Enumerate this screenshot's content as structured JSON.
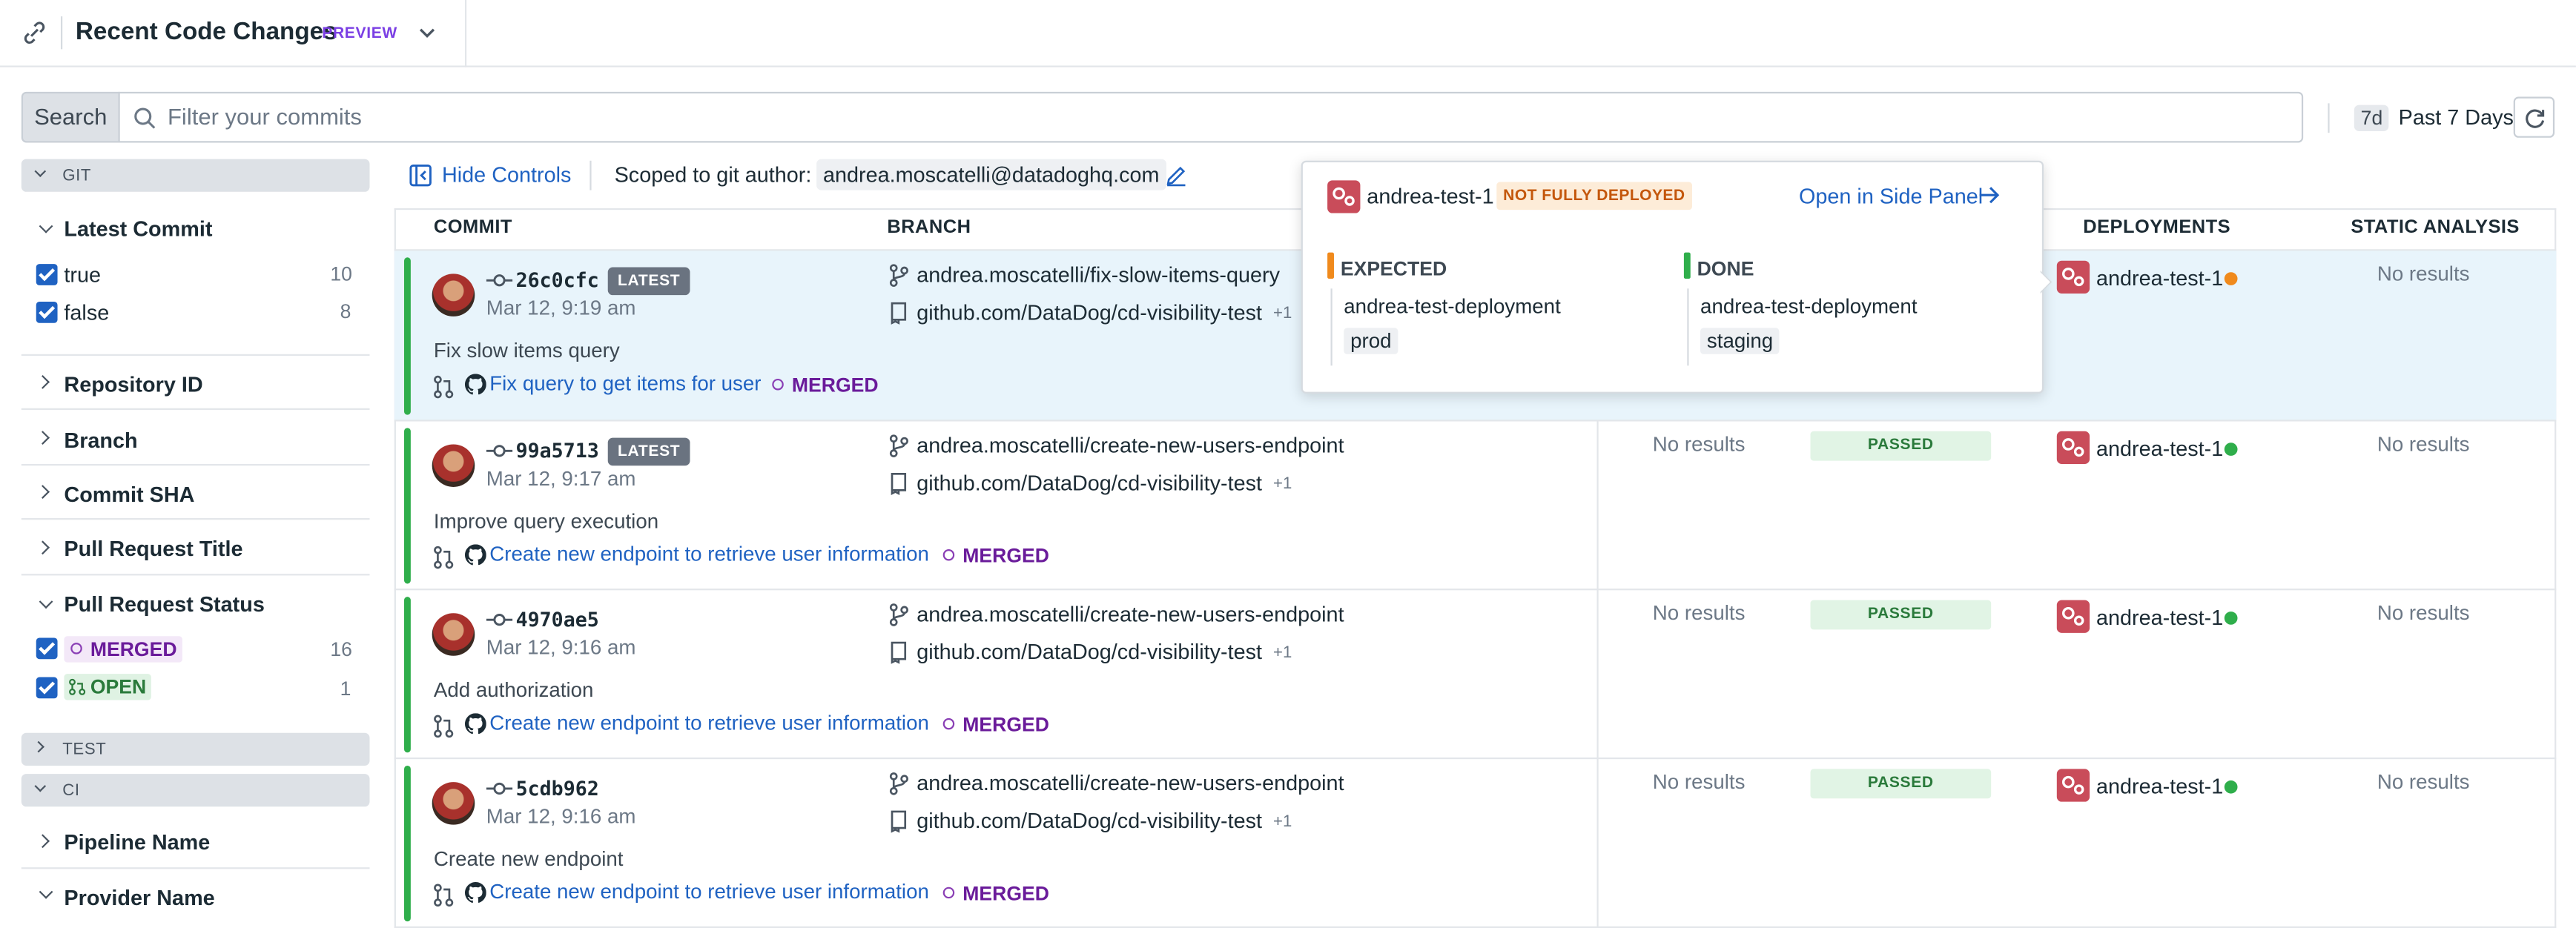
{
  "header": {
    "title": "Recent Code Changes",
    "preview": "PREVIEW"
  },
  "search": {
    "button": "Search",
    "placeholder": "Filter your commits",
    "time_short": "7d",
    "time_label": "Past 7 Days"
  },
  "controls": {
    "hide": "Hide Controls",
    "scoped_label": "Scoped to git author:",
    "author": "andrea.moscatelli@datadoghq.com"
  },
  "sidebar": {
    "git": "GIT",
    "latest_commit": "Latest Commit",
    "lc_options": [
      {
        "label": "true",
        "count": "10"
      },
      {
        "label": "false",
        "count": "8"
      }
    ],
    "facets": [
      "Repository ID",
      "Branch",
      "Commit SHA",
      "Pull Request Title"
    ],
    "pr_status": "Pull Request Status",
    "pr_options": [
      {
        "label": "MERGED",
        "count": "16"
      },
      {
        "label": "OPEN",
        "count": "1"
      }
    ],
    "test": "TEST",
    "ci": "CI",
    "pipeline": "Pipeline Name",
    "provider": "Provider Name"
  },
  "table": {
    "columns": [
      "COMMIT",
      "BRANCH",
      "DEPLOYMENTS",
      "STATIC ANALYSIS"
    ],
    "rows": [
      {
        "sha": "26c0cfc",
        "latest": "LATEST",
        "date": "Mar 12, 9:19 am",
        "message": "Fix slow items query",
        "pr": "Fix query to get items for user",
        "status": "MERGED",
        "branch": "andrea.moscatelli/fix-slow-items-query",
        "repo": "github.com/DataDog/cd-visibility-test",
        "repo_more": "+1",
        "col3": "",
        "col4": "",
        "deployment": "andrea-test-1",
        "static": "No results"
      },
      {
        "sha": "99a5713",
        "latest": "LATEST",
        "date": "Mar 12, 9:17 am",
        "message": "Improve query execution",
        "pr": "Create new endpoint to retrieve user information",
        "status": "MERGED",
        "branch": "andrea.moscatelli/create-new-users-endpoint",
        "repo": "github.com/DataDog/cd-visibility-test",
        "repo_more": "+1",
        "col3": "No results",
        "col4": "PASSED",
        "deployment": "andrea-test-1",
        "static": "No results"
      },
      {
        "sha": "4970ae5",
        "latest": "",
        "date": "Mar 12, 9:16 am",
        "message": "Add authorization",
        "pr": "Create new endpoint to retrieve user information",
        "status": "MERGED",
        "branch": "andrea.moscatelli/create-new-users-endpoint",
        "repo": "github.com/DataDog/cd-visibility-test",
        "repo_more": "+1",
        "col3": "No results",
        "col4": "PASSED",
        "deployment": "andrea-test-1",
        "static": "No results"
      },
      {
        "sha": "5cdb962",
        "latest": "",
        "date": "Mar 12, 9:16 am",
        "message": "Create new endpoint",
        "pr": "Create new endpoint to retrieve user information",
        "status": "MERGED",
        "branch": "andrea.moscatelli/create-new-users-endpoint",
        "repo": "github.com/DataDog/cd-visibility-test",
        "repo_more": "+1",
        "col3": "No results",
        "col4": "PASSED",
        "deployment": "andrea-test-1",
        "static": "No results"
      }
    ]
  },
  "popover": {
    "service": "andrea-test-1",
    "status": "NOT FULLY DEPLOYED",
    "open": "Open in Side Panel",
    "expected": "EXPECTED",
    "expected_dep": "andrea-test-deployment",
    "expected_env": "prod",
    "done": "DONE",
    "done_dep": "andrea-test-deployment",
    "done_env": "staging"
  },
  "colors": {
    "accent": "#1f62c2",
    "merged": "#6a1b9a",
    "passed": "#2a7a3b",
    "warn": "#f08a1c",
    "ok": "#2fae4b",
    "deploy_icon": "#c94c5a"
  }
}
